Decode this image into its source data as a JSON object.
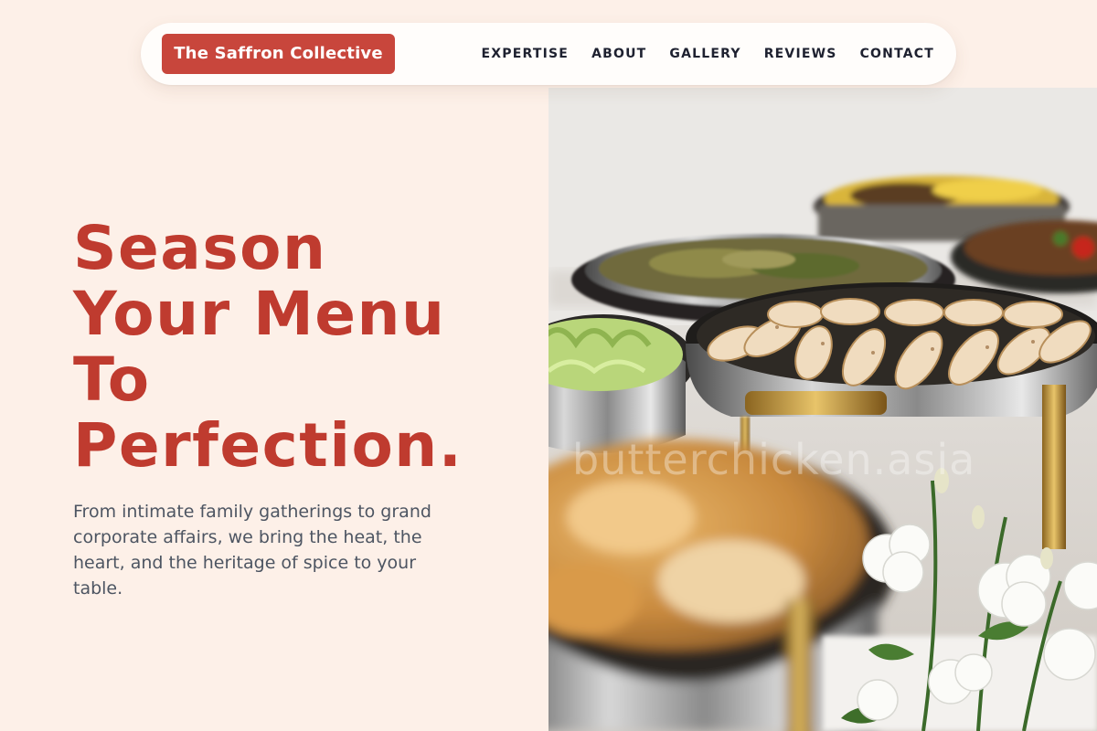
{
  "brand": {
    "name": "The Saffron Collective"
  },
  "nav": {
    "links": [
      "EXPERTISE",
      "ABOUT",
      "GALLERY",
      "REVIEWS",
      "CONTACT"
    ]
  },
  "hero": {
    "title_lines": [
      "Season",
      "Your Menu",
      "To",
      "Perfection."
    ],
    "description": "From intimate family gatherings to grand corporate affairs, we bring the heat, the heart, and the heritage of spice to your table.",
    "image": {
      "subject": "catering buffet chafing dishes with food and white flowers",
      "watermark": "butterchicken.asia"
    }
  },
  "colors": {
    "accent": "#c8463c",
    "heading": "#bf3b2f",
    "page_bg": "#fdf0e8",
    "nav_text": "#1e2130",
    "body_text": "#4d5562"
  }
}
